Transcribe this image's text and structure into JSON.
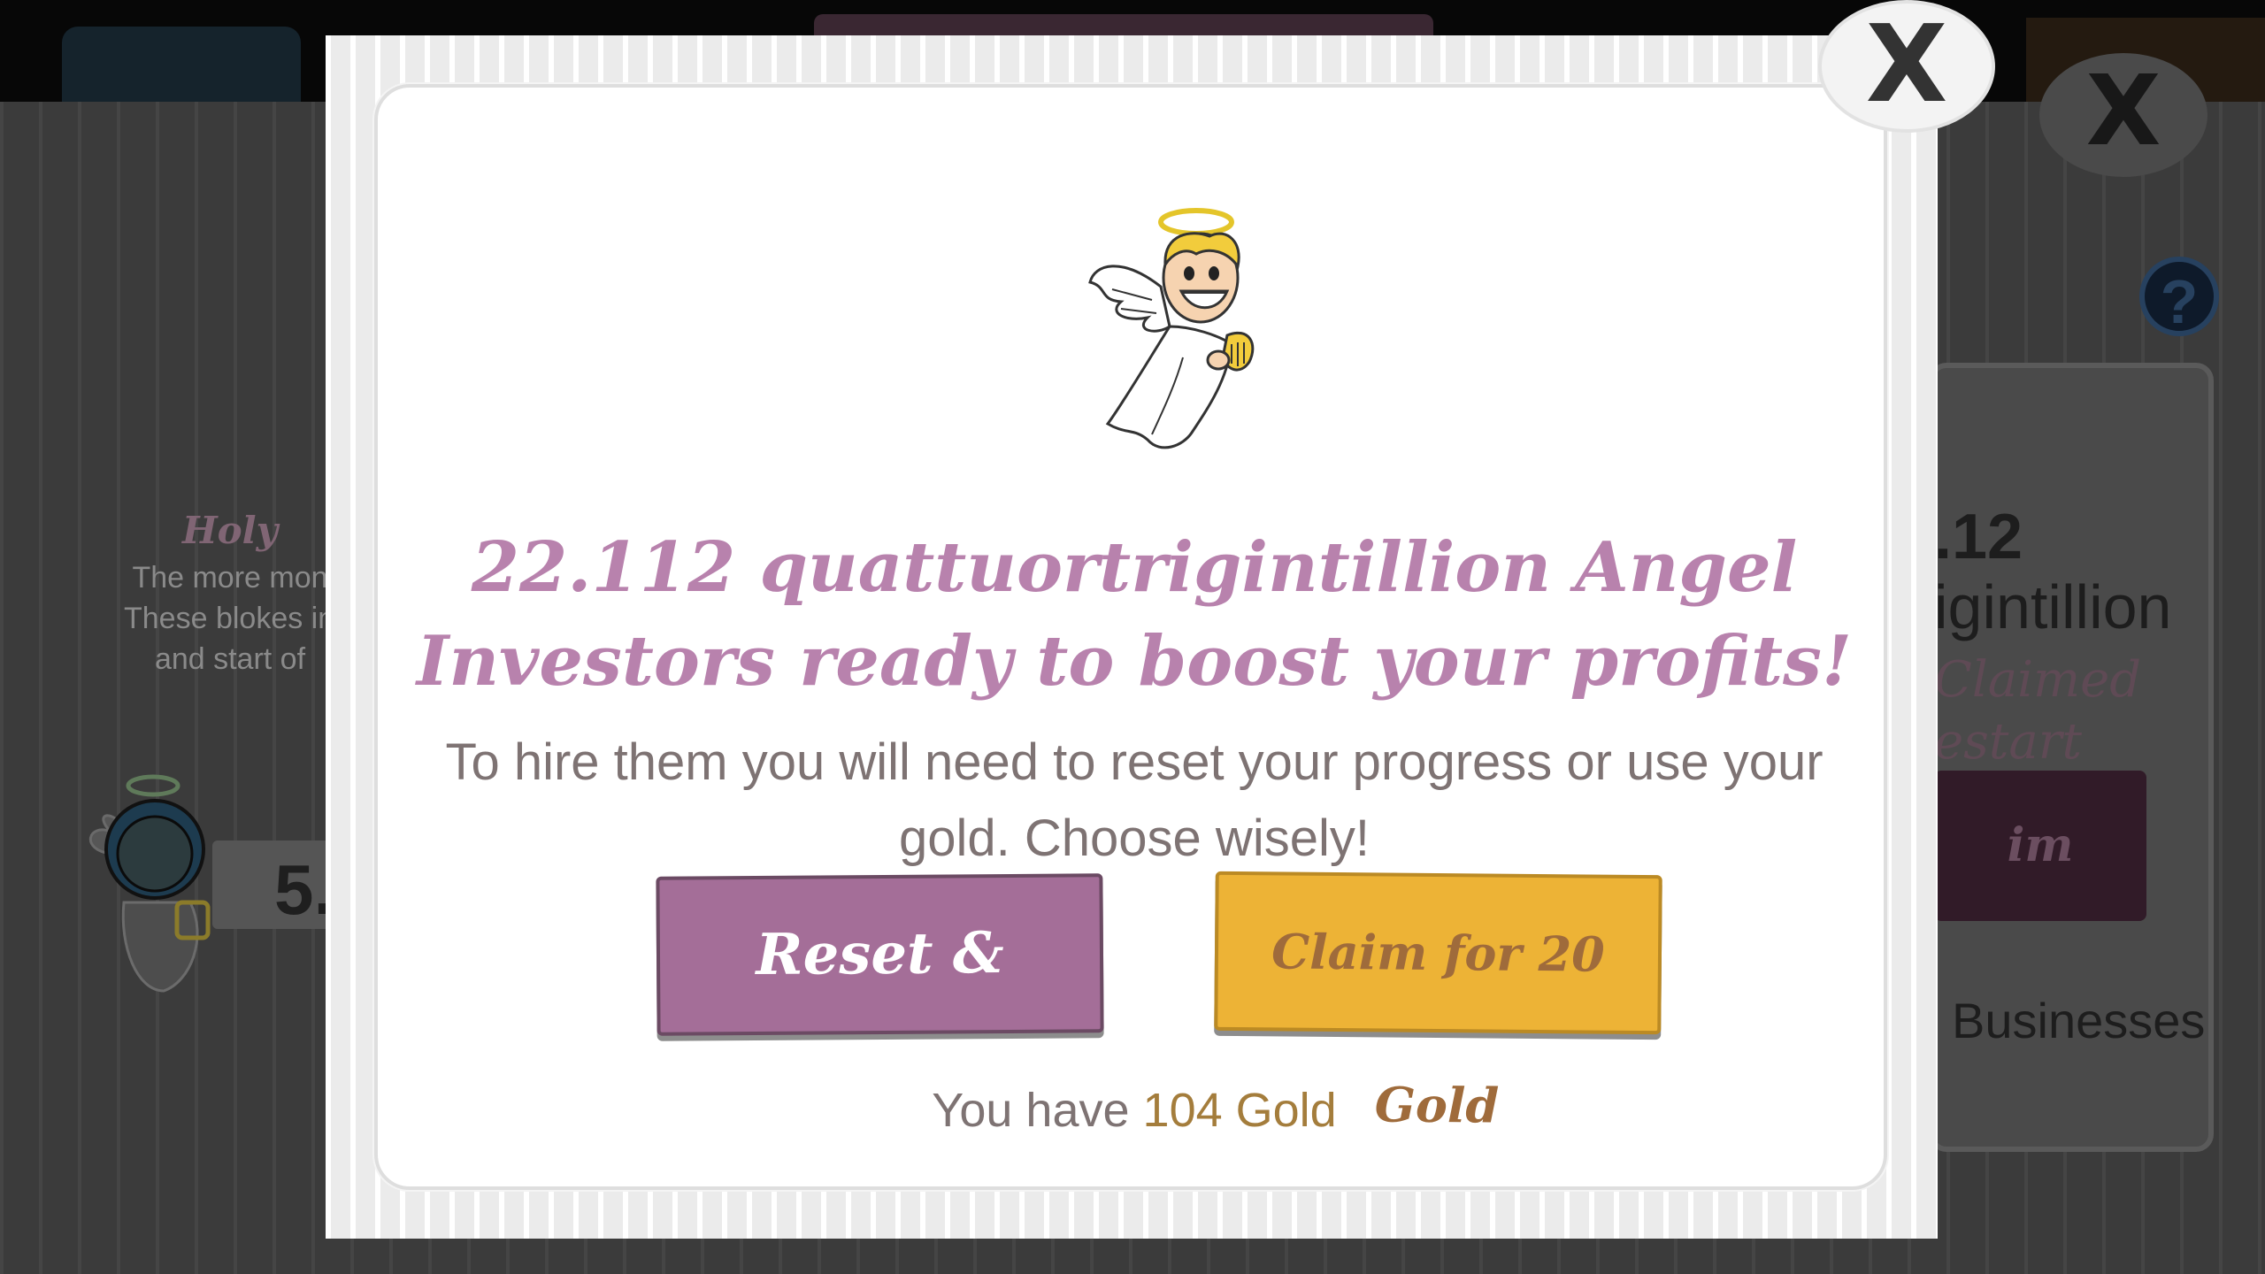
{
  "background": {
    "left_panel": {
      "title": "Holy",
      "lines": [
        "The more mon",
        "These blokes inc",
        "and start of"
      ],
      "value": "5."
    },
    "right_card": {
      "amount": ".12",
      "unit": "igintillion",
      "claimed": "Claimed",
      "restart": "estart",
      "button": "im",
      "businesses": "Businesses"
    },
    "help_symbol": "?",
    "close_symbol": "X"
  },
  "modal": {
    "headline": "22.112 quattuortrigintillion Angel Investors ready to boost your profits!",
    "body": "To hire them you will need to reset your progress or use your gold. Choose wisely!",
    "reset_button": "Reset & Claim",
    "gold_button": "Claim for 20 Gold",
    "gold_status_label": "You have ",
    "gold_status_amount": "104 Gold",
    "close_symbol": "X"
  },
  "icons": {
    "angel": "angel-investor-icon",
    "close": "close-icon",
    "help": "help-icon"
  },
  "colors": {
    "accent_purple": "#a46e98",
    "headline_purple": "#b882ad",
    "gold": "#edb336",
    "gold_text": "#a47d3c"
  }
}
